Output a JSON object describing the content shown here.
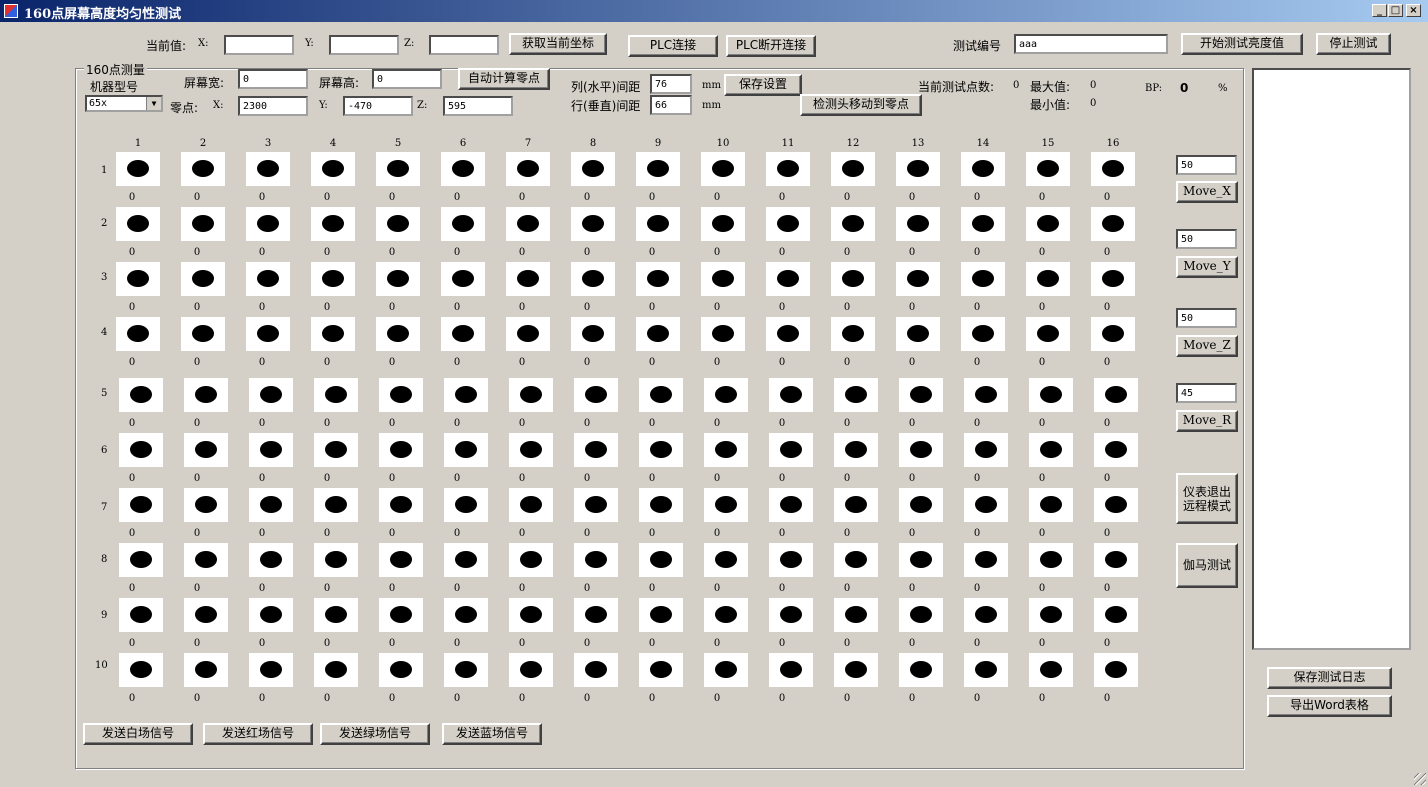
{
  "window": {
    "title": "160点屏幕高度均匀性测试",
    "controls": [
      "_",
      "□",
      "×"
    ]
  },
  "top": {
    "current_value_label": "当前值:",
    "x_label": "X:",
    "y_label": "Y:",
    "z_label": "Z:",
    "x_value": "",
    "y_value": "",
    "z_value": "",
    "get_coord_button": "获取当前坐标",
    "plc_connect_button": "PLC连接",
    "plc_disconnect_button": "PLC断开连接",
    "test_no_label": "测试编号",
    "test_no_value": "aaa",
    "start_button": "开始测试亮度值",
    "stop_button": "停止测试"
  },
  "group": {
    "title": "160点测量",
    "model_label": "机器型号",
    "model_value": "65x",
    "screen_width_label": "屏幕宽:",
    "screen_width_value": "0",
    "screen_height_label": "屏幕高:",
    "screen_height_value": "0",
    "auto_zero_button": "自动计算零点",
    "zero_label": "零点:",
    "zero_x_label": "X:",
    "zero_x_value": "2300",
    "zero_y_label": "Y:",
    "zero_y_value": "-470",
    "zero_z_label": "Z:",
    "zero_z_value": "595",
    "col_spacing_label": "列(水平)间距",
    "col_spacing_value": "76",
    "row_spacing_label": "行(垂直)间距",
    "row_spacing_value": "66",
    "mm1": "mm",
    "mm2": "mm",
    "save_settings_button": "保存设置",
    "move_to_zero_button": "检测头移动到零点",
    "current_count_label": "当前测试点数:",
    "current_count_value": "0",
    "max_label": "最大值:",
    "max_value": "0",
    "min_label": "最小值:",
    "min_value": "0",
    "bp_label": "BP:",
    "bp_value": "0",
    "bp_unit": "%"
  },
  "grid": {
    "columns": [
      "1",
      "2",
      "3",
      "4",
      "5",
      "6",
      "7",
      "8",
      "9",
      "10",
      "11",
      "12",
      "13",
      "14",
      "15",
      "16"
    ],
    "rows": [
      "1",
      "2",
      "3",
      "4",
      "5",
      "6",
      "7",
      "8",
      "9",
      "10"
    ],
    "values": [
      [
        "0",
        "0",
        "0",
        "0",
        "0",
        "0",
        "0",
        "0",
        "0",
        "0",
        "0",
        "0",
        "0",
        "0",
        "0",
        "0"
      ],
      [
        "0",
        "0",
        "0",
        "0",
        "0",
        "0",
        "0",
        "0",
        "0",
        "0",
        "0",
        "0",
        "0",
        "0",
        "0",
        "0"
      ],
      [
        "0",
        "0",
        "0",
        "0",
        "0",
        "0",
        "0",
        "0",
        "0",
        "0",
        "0",
        "0",
        "0",
        "0",
        "0",
        "0"
      ],
      [
        "0",
        "0",
        "0",
        "0",
        "0",
        "0",
        "0",
        "0",
        "0",
        "0",
        "0",
        "0",
        "0",
        "0",
        "0",
        "0"
      ],
      [
        "0",
        "0",
        "0",
        "0",
        "0",
        "0",
        "0",
        "0",
        "0",
        "0",
        "0",
        "0",
        "0",
        "0",
        "0",
        "0"
      ],
      [
        "0",
        "0",
        "0",
        "0",
        "0",
        "0",
        "0",
        "0",
        "0",
        "0",
        "0",
        "0",
        "0",
        "0",
        "0",
        "0"
      ],
      [
        "0",
        "0",
        "0",
        "0",
        "0",
        "0",
        "0",
        "0",
        "0",
        "0",
        "0",
        "0",
        "0",
        "0",
        "0",
        "0"
      ],
      [
        "0",
        "0",
        "0",
        "0",
        "0",
        "0",
        "0",
        "0",
        "0",
        "0",
        "0",
        "0",
        "0",
        "0",
        "0",
        "0"
      ],
      [
        "0",
        "0",
        "0",
        "0",
        "0",
        "0",
        "0",
        "0",
        "0",
        "0",
        "0",
        "0",
        "0",
        "0",
        "0",
        "0"
      ],
      [
        "0",
        "0",
        "0",
        "0",
        "0",
        "0",
        "0",
        "0",
        "0",
        "0",
        "0",
        "0",
        "0",
        "0",
        "0",
        "0"
      ]
    ]
  },
  "signals": {
    "white": "发送白场信号",
    "red": "发送红场信号",
    "green": "发送绿场信号",
    "blue": "发送蓝场信号"
  },
  "moves": [
    {
      "value": "50",
      "label": "Move_X"
    },
    {
      "value": "50",
      "label": "Move_Y"
    },
    {
      "value": "50",
      "label": "Move_Z"
    },
    {
      "value": "45",
      "label": "Move_R"
    }
  ],
  "side": {
    "exit_remote_button": "仪表退出远程模式",
    "gamma_button": "伽马测试",
    "save_log_button": "保存测试日志",
    "export_word_button": "导出Word表格"
  }
}
